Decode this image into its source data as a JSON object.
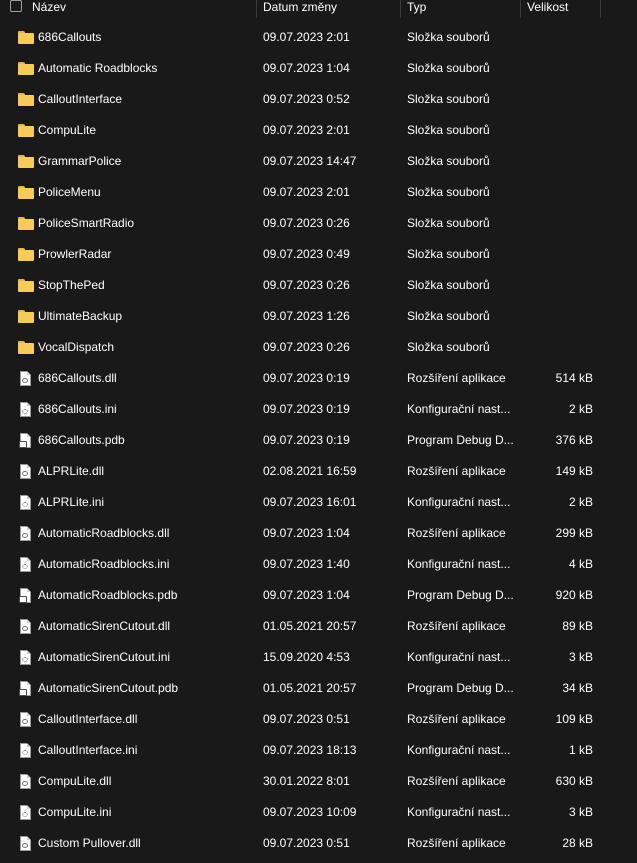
{
  "header": {
    "col_name": "Název",
    "col_date": "Datum změny",
    "col_type": "Typ",
    "col_size": "Velikost"
  },
  "rows": [
    {
      "kind": "folder",
      "icon": "folder-icon",
      "name": "686Callouts",
      "date": "09.07.2023 2:01",
      "type": "Složka souborů",
      "size": ""
    },
    {
      "kind": "folder",
      "icon": "folder-icon",
      "name": "Automatic Roadblocks",
      "date": "09.07.2023 1:04",
      "type": "Složka souborů",
      "size": ""
    },
    {
      "kind": "folder",
      "icon": "folder-icon",
      "name": "CalloutInterface",
      "date": "09.07.2023 0:52",
      "type": "Složka souborů",
      "size": ""
    },
    {
      "kind": "folder",
      "icon": "folder-icon",
      "name": "CompuLite",
      "date": "09.07.2023 2:01",
      "type": "Složka souborů",
      "size": ""
    },
    {
      "kind": "folder",
      "icon": "folder-icon",
      "name": "GrammarPolice",
      "date": "09.07.2023 14:47",
      "type": "Složka souborů",
      "size": ""
    },
    {
      "kind": "folder",
      "icon": "folder-icon",
      "name": "PoliceMenu",
      "date": "09.07.2023 2:01",
      "type": "Složka souborů",
      "size": ""
    },
    {
      "kind": "folder",
      "icon": "folder-icon",
      "name": "PoliceSmartRadio",
      "date": "09.07.2023 0:26",
      "type": "Složka souborů",
      "size": ""
    },
    {
      "kind": "folder",
      "icon": "folder-icon",
      "name": "ProwlerRadar",
      "date": "09.07.2023 0:49",
      "type": "Složka souborů",
      "size": ""
    },
    {
      "kind": "folder",
      "icon": "folder-icon",
      "name": "StopThePed",
      "date": "09.07.2023 0:26",
      "type": "Složka souborů",
      "size": ""
    },
    {
      "kind": "folder",
      "icon": "folder-icon",
      "name": "UltimateBackup",
      "date": "09.07.2023 1:26",
      "type": "Složka souborů",
      "size": ""
    },
    {
      "kind": "folder",
      "icon": "folder-icon",
      "name": "VocalDispatch",
      "date": "09.07.2023 0:26",
      "type": "Složka souborů",
      "size": ""
    },
    {
      "kind": "dll",
      "icon": "dll-file-icon",
      "name": "686Callouts.dll",
      "date": "09.07.2023 0:19",
      "type": "Rozšíření aplikace",
      "size": "514 kB"
    },
    {
      "kind": "ini",
      "icon": "ini-file-icon",
      "name": "686Callouts.ini",
      "date": "09.07.2023 0:19",
      "type": "Konfigurační nast...",
      "size": "2 kB"
    },
    {
      "kind": "pdb",
      "icon": "pdb-file-icon",
      "name": "686Callouts.pdb",
      "date": "09.07.2023 0:19",
      "type": "Program Debug D...",
      "size": "376 kB"
    },
    {
      "kind": "dll",
      "icon": "dll-file-icon",
      "name": "ALPRLite.dll",
      "date": "02.08.2021 16:59",
      "type": "Rozšíření aplikace",
      "size": "149 kB"
    },
    {
      "kind": "ini",
      "icon": "ini-file-icon",
      "name": "ALPRLite.ini",
      "date": "09.07.2023 16:01",
      "type": "Konfigurační nast...",
      "size": "2 kB"
    },
    {
      "kind": "dll",
      "icon": "dll-file-icon",
      "name": "AutomaticRoadblocks.dll",
      "date": "09.07.2023 1:04",
      "type": "Rozšíření aplikace",
      "size": "299 kB"
    },
    {
      "kind": "ini",
      "icon": "ini-file-icon",
      "name": "AutomaticRoadblocks.ini",
      "date": "09.07.2023 1:40",
      "type": "Konfigurační nast...",
      "size": "4 kB"
    },
    {
      "kind": "pdb",
      "icon": "pdb-file-icon",
      "name": "AutomaticRoadblocks.pdb",
      "date": "09.07.2023 1:04",
      "type": "Program Debug D...",
      "size": "920 kB"
    },
    {
      "kind": "dll",
      "icon": "dll-file-icon",
      "name": "AutomaticSirenCutout.dll",
      "date": "01.05.2021 20:57",
      "type": "Rozšíření aplikace",
      "size": "89 kB"
    },
    {
      "kind": "ini",
      "icon": "ini-file-icon",
      "name": "AutomaticSirenCutout.ini",
      "date": "15.09.2020 4:53",
      "type": "Konfigurační nast...",
      "size": "3 kB"
    },
    {
      "kind": "pdb",
      "icon": "pdb-file-icon",
      "name": "AutomaticSirenCutout.pdb",
      "date": "01.05.2021 20:57",
      "type": "Program Debug D...",
      "size": "34 kB"
    },
    {
      "kind": "dll",
      "icon": "dll-file-icon",
      "name": "CalloutInterface.dll",
      "date": "09.07.2023 0:51",
      "type": "Rozšíření aplikace",
      "size": "109 kB"
    },
    {
      "kind": "ini",
      "icon": "ini-file-icon",
      "name": "CalloutInterface.ini",
      "date": "09.07.2023 18:13",
      "type": "Konfigurační nast...",
      "size": "1 kB"
    },
    {
      "kind": "dll",
      "icon": "dll-file-icon",
      "name": "CompuLite.dll",
      "date": "30.01.2022 8:01",
      "type": "Rozšíření aplikace",
      "size": "630 kB"
    },
    {
      "kind": "ini",
      "icon": "ini-file-icon",
      "name": "CompuLite.ini",
      "date": "09.07.2023 10:09",
      "type": "Konfigurační nast...",
      "size": "3 kB"
    },
    {
      "kind": "dll",
      "icon": "dll-file-icon",
      "name": "Custom Pullover.dll",
      "date": "09.07.2023 0:51",
      "type": "Rozšíření aplikace",
      "size": "28 kB"
    }
  ]
}
